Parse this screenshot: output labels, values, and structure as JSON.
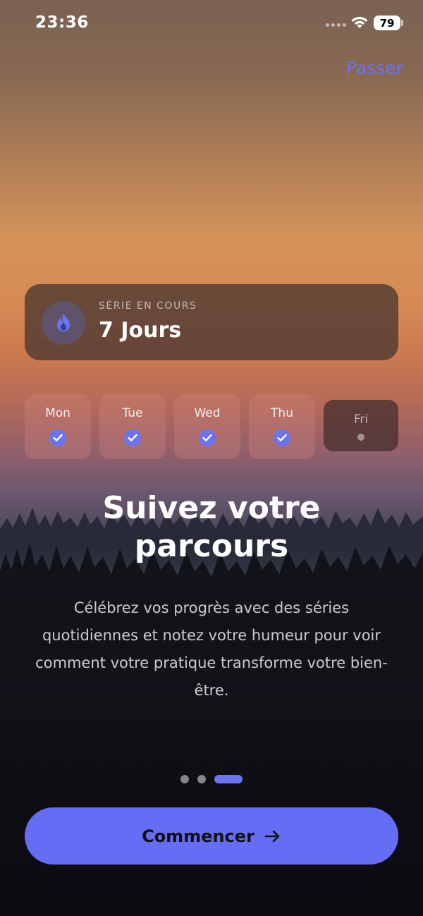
{
  "status_bar": {
    "time": "23:36",
    "battery": "79"
  },
  "header": {
    "skip_label": "Passer"
  },
  "streak": {
    "label": "SÉRIE EN COURS",
    "value": "7 Jours",
    "icon": "flame-icon"
  },
  "week": {
    "days": [
      {
        "label": "Mon",
        "completed": true
      },
      {
        "label": "Tue",
        "completed": true
      },
      {
        "label": "Wed",
        "completed": true
      },
      {
        "label": "Thu",
        "completed": true
      },
      {
        "label": "Fri",
        "completed": false
      }
    ]
  },
  "content": {
    "title_line1": "Suivez votre",
    "title_line2": "parcours",
    "description": "Célébrez vos progrès avec des séries quotidiennes et notez votre humeur pour voir comment votre pratique transforme votre bien-être."
  },
  "pager": {
    "current_page": 3,
    "total_pages": 3
  },
  "cta": {
    "label": "Commencer",
    "icon": "arrow-right-icon"
  },
  "colors": {
    "accent": "#666df5",
    "skip_text": "#6c72f2"
  }
}
